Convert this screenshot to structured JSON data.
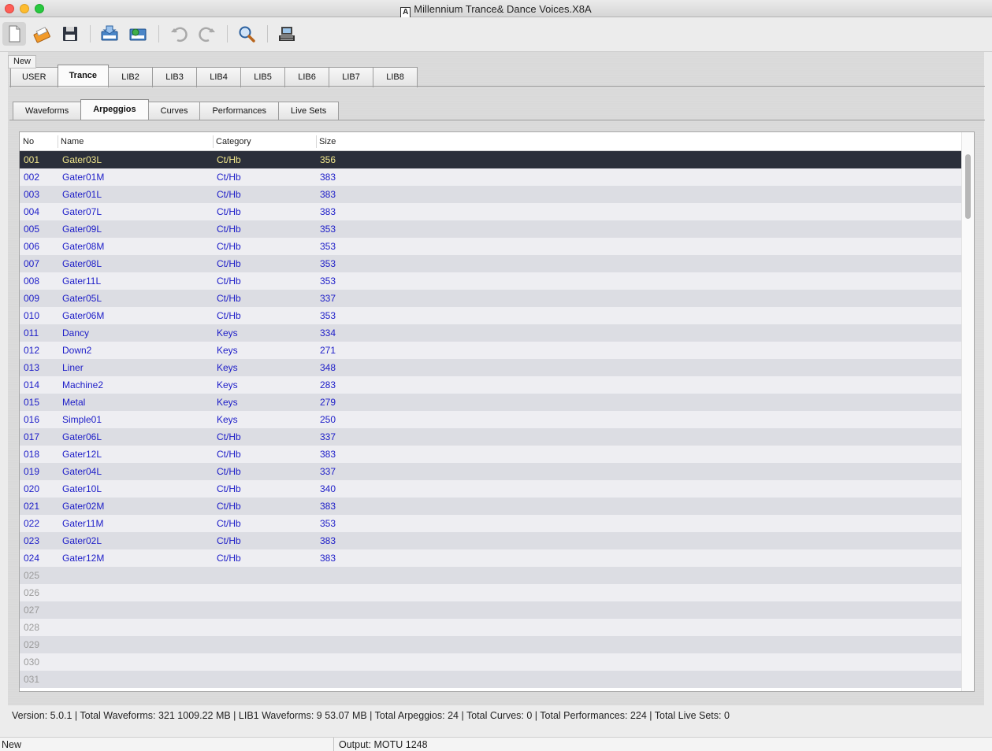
{
  "window": {
    "title": "Millennium Trance& Dance Voices.X8A",
    "doc_icon_letter": "A"
  },
  "toolbar": {
    "buttons": [
      {
        "name": "new-icon"
      },
      {
        "name": "edit-icon"
      },
      {
        "name": "save-icon"
      },
      {
        "name": "receive-icon"
      },
      {
        "name": "send-icon"
      },
      {
        "name": "undo-icon"
      },
      {
        "name": "redo-icon"
      },
      {
        "name": "search-icon"
      },
      {
        "name": "device-icon"
      }
    ],
    "tooltip": "New"
  },
  "lib_tabs": [
    "USER",
    "Trance",
    "LIB2",
    "LIB3",
    "LIB4",
    "LIB5",
    "LIB6",
    "LIB7",
    "LIB8"
  ],
  "lib_tab_selected": "Trance",
  "sub_tabs": [
    "Waveforms",
    "Arpeggios",
    "Curves",
    "Performances",
    "Live Sets"
  ],
  "sub_tab_selected": "Arpeggios",
  "table": {
    "columns": [
      "No",
      "Name",
      "Category",
      "Size"
    ],
    "rows": [
      {
        "no": "001",
        "name": "Gater03L",
        "category": "Ct/Hb",
        "size": "356"
      },
      {
        "no": "002",
        "name": "Gater01M",
        "category": "Ct/Hb",
        "size": "383"
      },
      {
        "no": "003",
        "name": "Gater01L",
        "category": "Ct/Hb",
        "size": "383"
      },
      {
        "no": "004",
        "name": "Gater07L",
        "category": "Ct/Hb",
        "size": "383"
      },
      {
        "no": "005",
        "name": "Gater09L",
        "category": "Ct/Hb",
        "size": "353"
      },
      {
        "no": "006",
        "name": "Gater08M",
        "category": "Ct/Hb",
        "size": "353"
      },
      {
        "no": "007",
        "name": "Gater08L",
        "category": "Ct/Hb",
        "size": "353"
      },
      {
        "no": "008",
        "name": "Gater11L",
        "category": "Ct/Hb",
        "size": "353"
      },
      {
        "no": "009",
        "name": "Gater05L",
        "category": "Ct/Hb",
        "size": "337"
      },
      {
        "no": "010",
        "name": "Gater06M",
        "category": "Ct/Hb",
        "size": "353"
      },
      {
        "no": "011",
        "name": "Dancy",
        "category": "Keys",
        "size": "334"
      },
      {
        "no": "012",
        "name": "Down2",
        "category": "Keys",
        "size": "271"
      },
      {
        "no": "013",
        "name": "Liner",
        "category": "Keys",
        "size": "348"
      },
      {
        "no": "014",
        "name": "Machine2",
        "category": "Keys",
        "size": "283"
      },
      {
        "no": "015",
        "name": "Metal",
        "category": "Keys",
        "size": "279"
      },
      {
        "no": "016",
        "name": "Simple01",
        "category": "Keys",
        "size": "250"
      },
      {
        "no": "017",
        "name": "Gater06L",
        "category": "Ct/Hb",
        "size": "337"
      },
      {
        "no": "018",
        "name": "Gater12L",
        "category": "Ct/Hb",
        "size": "383"
      },
      {
        "no": "019",
        "name": "Gater04L",
        "category": "Ct/Hb",
        "size": "337"
      },
      {
        "no": "020",
        "name": "Gater10L",
        "category": "Ct/Hb",
        "size": "340"
      },
      {
        "no": "021",
        "name": "Gater02M",
        "category": "Ct/Hb",
        "size": "383"
      },
      {
        "no": "022",
        "name": "Gater11M",
        "category": "Ct/Hb",
        "size": "353"
      },
      {
        "no": "023",
        "name": "Gater02L",
        "category": "Ct/Hb",
        "size": "383"
      },
      {
        "no": "024",
        "name": "Gater12M",
        "category": "Ct/Hb",
        "size": "383"
      },
      {
        "no": "025",
        "name": "",
        "category": "",
        "size": ""
      },
      {
        "no": "026",
        "name": "",
        "category": "",
        "size": ""
      },
      {
        "no": "027",
        "name": "",
        "category": "",
        "size": ""
      },
      {
        "no": "028",
        "name": "",
        "category": "",
        "size": ""
      },
      {
        "no": "029",
        "name": "",
        "category": "",
        "size": ""
      },
      {
        "no": "030",
        "name": "",
        "category": "",
        "size": ""
      },
      {
        "no": "031",
        "name": "",
        "category": "",
        "size": ""
      }
    ],
    "selected_row": "001"
  },
  "status": {
    "text": "Version: 5.0.1    |    Total Waveforms: 321   1009.22 MB    |    LIB1  Waveforms: 9    53.07 MB    |    Total Arpeggios: 24    |    Total Curves: 0    |    Total Performances: 224    |    Total Live Sets: 0"
  },
  "footer": {
    "left": "New",
    "right": "Output: MOTU 1248"
  },
  "colors": {
    "row_text": "#1c1cc8",
    "selected_row_bg": "#2b2f3a",
    "selected_row_text": "#f0e68c"
  }
}
